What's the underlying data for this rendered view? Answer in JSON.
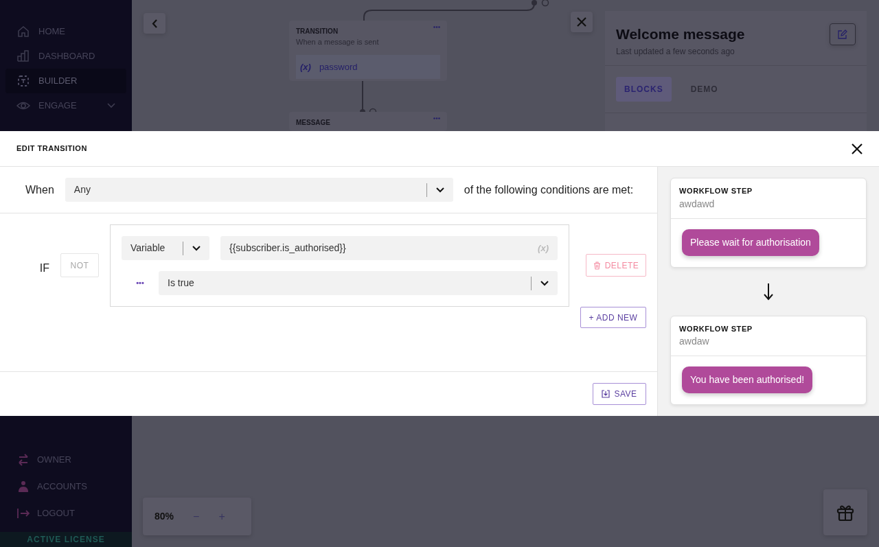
{
  "sidebar": {
    "items": [
      {
        "kind": "home",
        "label": "HOME",
        "selected": false,
        "submenu": false
      },
      {
        "kind": "chart",
        "label": "DASHBOARD",
        "selected": false,
        "submenu": false
      },
      {
        "kind": "builder",
        "label": "BUILDER",
        "selected": true,
        "submenu": false
      },
      {
        "kind": "eye",
        "label": "ENGAGE",
        "selected": false,
        "submenu": true
      }
    ],
    "footer_items": [
      {
        "kind": "swap",
        "label": "OWNER"
      },
      {
        "kind": "person",
        "label": "ACCOUNTS"
      },
      {
        "kind": "logout",
        "label": "LOGOUT"
      }
    ],
    "license": "ACTIVE LICENSE"
  },
  "canvas": {
    "nodes": [
      {
        "title": "TRANSITION",
        "subtitle": "When a message is sent",
        "variable_tag": "(x)",
        "variable": "password"
      },
      {
        "title": "MESSAGE"
      }
    ],
    "zoom": {
      "value": "80%",
      "minus": "−",
      "plus": "+"
    }
  },
  "panel": {
    "title": "Welcome message",
    "subtitle": "Last updated a few seconds ago",
    "tabs": [
      {
        "label": "BLOCKS",
        "selected": true
      },
      {
        "label": "DEMO",
        "selected": false
      }
    ]
  },
  "modal": {
    "title": "EDIT TRANSITION",
    "when_label": "When",
    "match": "Any",
    "match_suffix": "of the following conditions are met:",
    "condition": {
      "if_label": "IF",
      "not_label": "NOT",
      "not_disabled": true,
      "source": "Variable",
      "value": "{{subscriber.is_authorised}}",
      "value_tag": "(x)",
      "more": "•••",
      "operator": "Is true"
    },
    "delete": "DELETE",
    "add_new": "+ ADD NEW",
    "save": "SAVE",
    "steps": [
      {
        "label": "WORKFLOW STEP",
        "name": "awdawd",
        "message": "Please wait for authorisation"
      },
      {
        "label": "WORKFLOW STEP",
        "name": "awdaw",
        "message": "You have been authorised!"
      }
    ]
  }
}
